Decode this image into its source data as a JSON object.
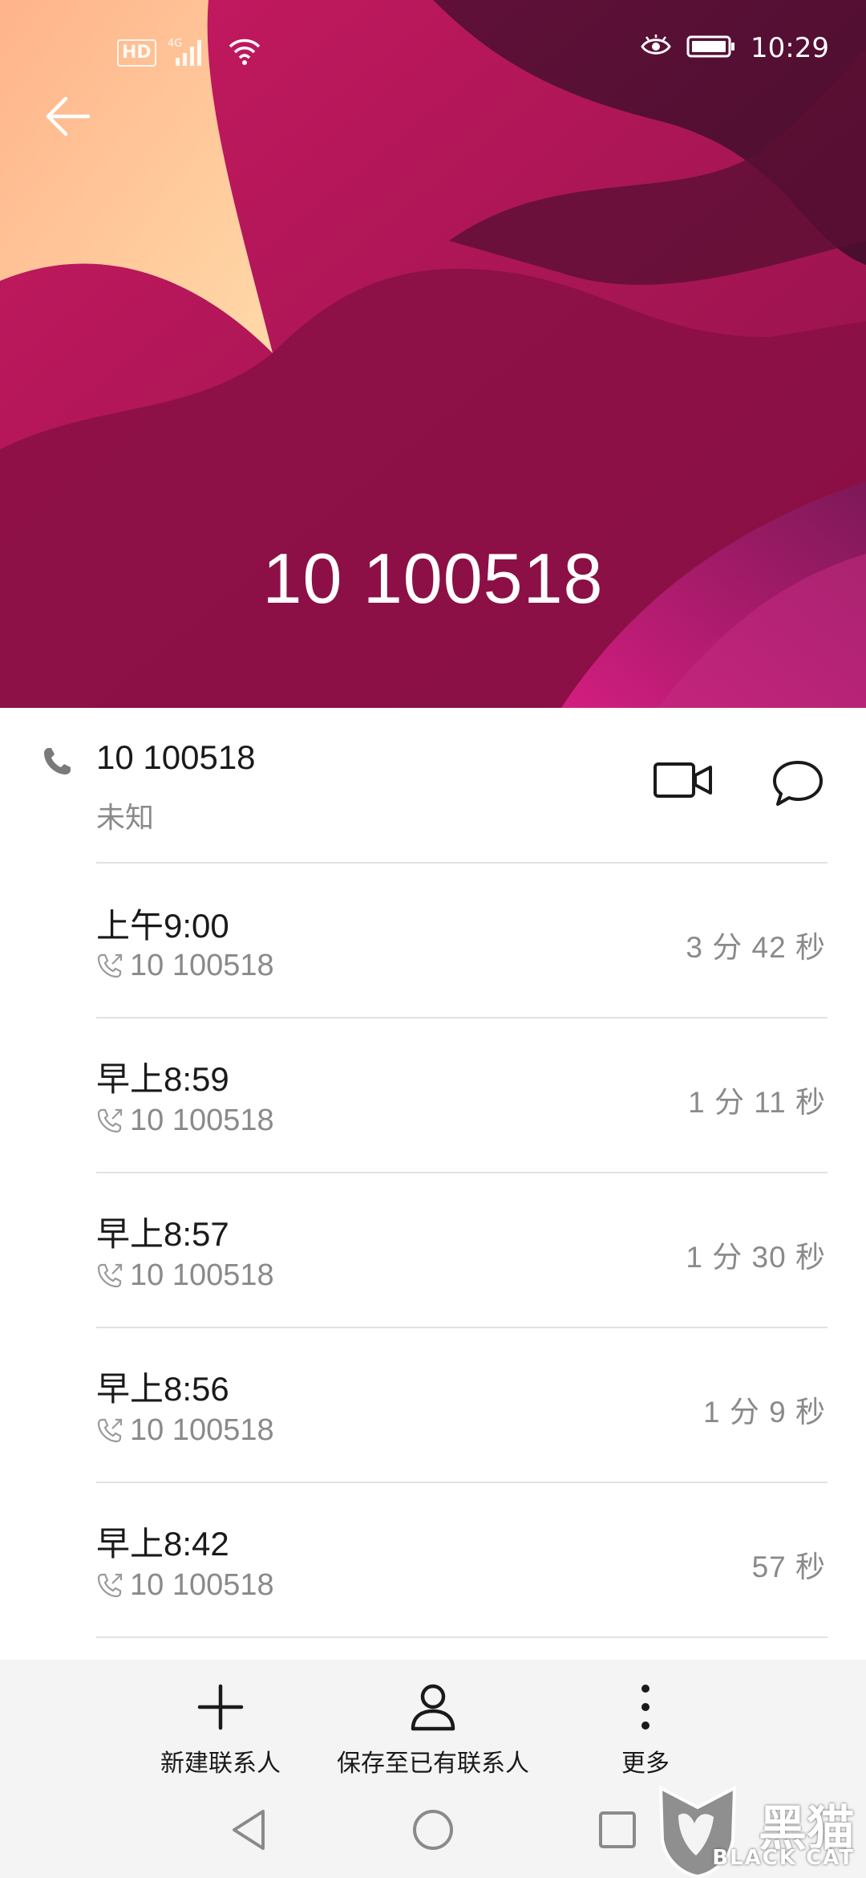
{
  "status_bar": {
    "hd": "HD",
    "network": "4G",
    "time": "10:29"
  },
  "header": {
    "number": "10 100518"
  },
  "contact": {
    "number": "10 100518",
    "label": "未知"
  },
  "call_log": [
    {
      "time": "上午9:00",
      "number": "10 100518",
      "duration": "3 分 42 秒"
    },
    {
      "time": "早上8:59",
      "number": "10 100518",
      "duration": "1 分 11 秒"
    },
    {
      "time": "早上8:57",
      "number": "10 100518",
      "duration": "1 分 30 秒"
    },
    {
      "time": "早上8:56",
      "number": "10 100518",
      "duration": "1 分 9 秒"
    },
    {
      "time": "早上8:42",
      "number": "10 100518",
      "duration": "57 秒"
    }
  ],
  "actions": {
    "new_contact": "新建联系人",
    "save_existing": "保存至已有联系人",
    "more": "更多"
  },
  "watermark": {
    "cn": "黑猫",
    "en": "BLACK CAT"
  }
}
